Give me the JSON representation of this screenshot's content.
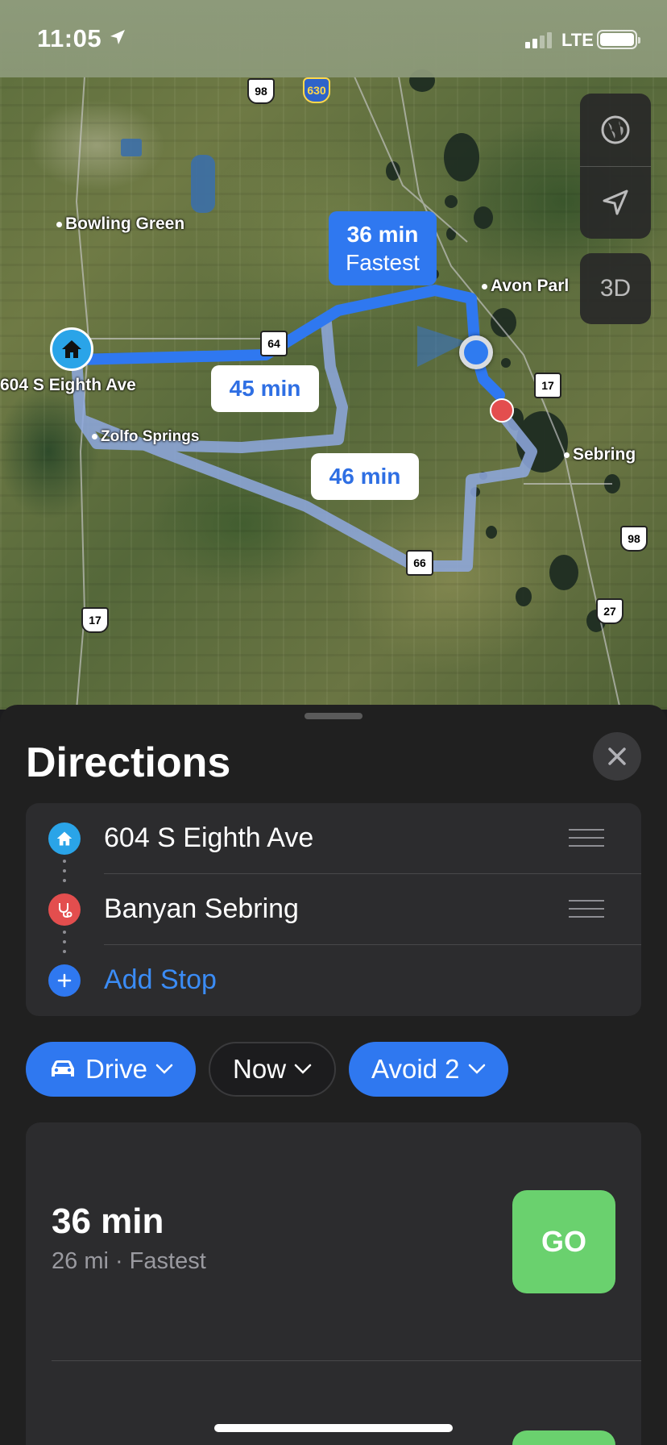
{
  "status_bar": {
    "time": "11:05",
    "network": "LTE"
  },
  "map": {
    "places": {
      "bowling_green": "Bowling Green",
      "avon_park": "Avon Parl",
      "sebring": "Sebring",
      "zolfo_springs": "Zolfo Springs",
      "origin_label": "604 S Eighth Ave"
    },
    "shields": {
      "us98_top": "98",
      "cr630": "630",
      "sr64": "64",
      "us17_east": "17",
      "us98_east": "98",
      "us27": "27",
      "sr66": "66",
      "us17_west": "17"
    },
    "route_labels": {
      "primary_time": "36 min",
      "primary_note": "Fastest",
      "alt1": "45 min",
      "alt2": "46 min"
    },
    "controls": {
      "view_3d": "3D"
    },
    "colors": {
      "route_primary": "#2f78f0",
      "route_alt": "#8fa9e0"
    }
  },
  "sheet": {
    "title": "Directions",
    "stops": [
      {
        "label": "604 S Eighth Ave",
        "icon": "home-icon",
        "color": "#2aa4e8"
      },
      {
        "label": "Banyan Sebring",
        "icon": "stethoscope-icon",
        "color": "#e34e4e"
      }
    ],
    "add_stop": "Add Stop",
    "chips": {
      "mode": "Drive",
      "time": "Now",
      "avoid": "Avoid 2"
    },
    "routes": [
      {
        "time": "36 min",
        "details": "26 mi · Fastest",
        "go": "GO"
      }
    ],
    "colors": {
      "accent": "#2f78f0",
      "go": "#6ad16e"
    }
  }
}
